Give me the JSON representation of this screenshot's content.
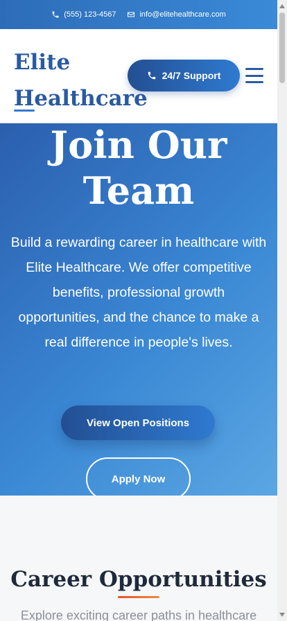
{
  "topbar": {
    "phone": "(555) 123-4567",
    "email": "info@elitehealthcare.com",
    "phone_icon": "phone-icon",
    "email_icon": "envelope-icon"
  },
  "header": {
    "logo_line1": "Elite",
    "logo_line2": "Healthcare",
    "support_label": "24/7 Support",
    "menu_icon": "hamburger-menu-icon"
  },
  "hero": {
    "title_line1": "Join Our",
    "title_line2": "Team",
    "description": "Build a rewarding career in healthcare with Elite Healthcare. We offer competitive benefits, professional growth opportunities, and the chance to make a real difference in people's lives.",
    "primary_button": "View Open Positions",
    "secondary_button": "Apply Now"
  },
  "careers": {
    "title": "Career Opportunities",
    "subtitle": "Explore exciting career paths in healthcare"
  },
  "colors": {
    "brand_blue": "#2a5aa0",
    "accent_blue": "#2f7ad0",
    "accent_orange": "#e4532b"
  }
}
